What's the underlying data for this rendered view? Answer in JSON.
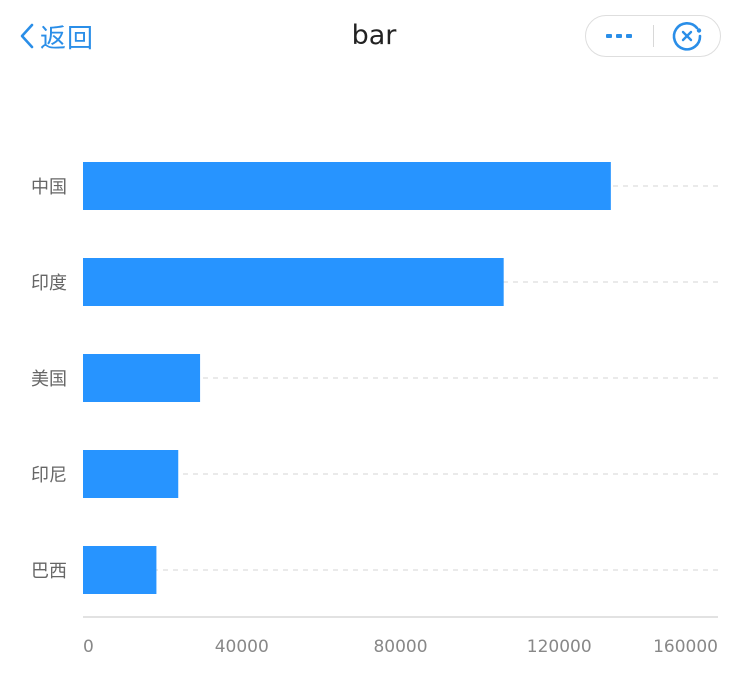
{
  "nav": {
    "back_label": "返回",
    "title": "bar"
  },
  "capsule": {
    "more_icon": "more-dots-icon",
    "close_icon": "close-circle-icon",
    "accent": "#2a8ee8"
  },
  "chart_data": {
    "type": "bar",
    "orientation": "horizontal",
    "categories": [
      "中国",
      "印度",
      "美国",
      "印尼",
      "巴西"
    ],
    "values": [
      133000,
      106000,
      29500,
      24000,
      18500
    ],
    "xlim": [
      0,
      160000
    ],
    "xticks": [
      "0",
      "40000",
      "80000",
      "120000",
      "160000"
    ],
    "title": "",
    "xlabel": "",
    "ylabel": "",
    "grid": "dashed",
    "bar_color": "#2794ff"
  }
}
